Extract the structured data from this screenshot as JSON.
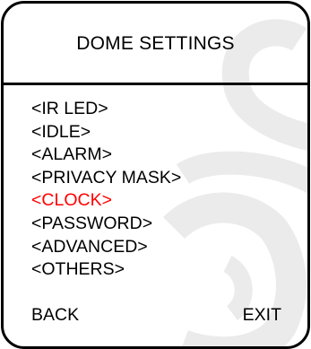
{
  "title": "DOME SETTINGS",
  "menu": {
    "items": [
      {
        "label": "<IR LED>"
      },
      {
        "label": "<IDLE>"
      },
      {
        "label": "<ALARM>"
      },
      {
        "label": "<PRIVACY MASK>"
      },
      {
        "label": "<CLOCK>"
      },
      {
        "label": "<PASSWORD>"
      },
      {
        "label": "<ADVANCED>"
      },
      {
        "label": "<OTHERS>"
      }
    ],
    "selected_index": 4
  },
  "footer": {
    "back_label": "BACK",
    "exit_label": "EXIT"
  },
  "colors": {
    "text": "#000000",
    "selected": "#ff0000",
    "frame": "#000000",
    "background": "#ffffff",
    "watermark": "#e8e8e8"
  }
}
